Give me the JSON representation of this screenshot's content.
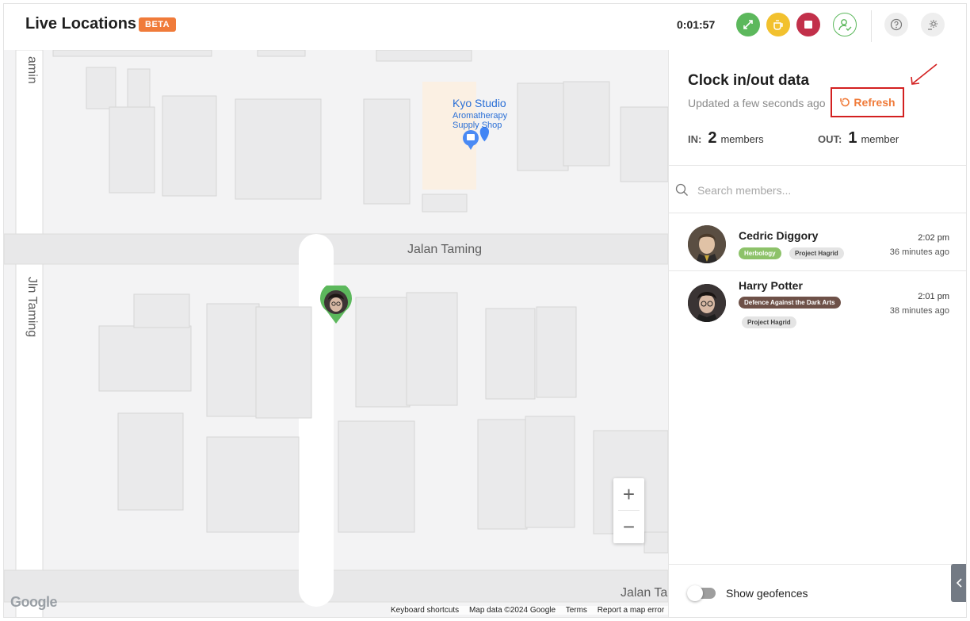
{
  "header": {
    "title": "Live Locations",
    "badge": "BETA",
    "timer": "0:01:57"
  },
  "map": {
    "street_labels": [
      "amin",
      "Jln Taming",
      "Jalan Taming",
      "Jalan Ta"
    ],
    "poi": {
      "name": "Kyo Studio",
      "subtitle": "Aromatherapy Supply Shop"
    },
    "zoom_in": "+",
    "zoom_out": "−",
    "logo": "Google",
    "attribution": [
      "Keyboard shortcuts",
      "Map data ©2024 Google",
      "Terms",
      "Report a map error"
    ]
  },
  "panel": {
    "title": "Clock in/out data",
    "updated": "Updated a few seconds ago",
    "refresh_label": "Refresh",
    "in_label": "IN:",
    "in_count": "2",
    "in_unit": "members",
    "out_label": "OUT:",
    "out_count": "1",
    "out_unit": "member",
    "search_placeholder": "Search members...",
    "members": [
      {
        "name": "Cedric Diggory",
        "tags": [
          "Herbology",
          "Project Hagrid"
        ],
        "time": "2:02 pm",
        "ago": "36 minutes ago"
      },
      {
        "name": "Harry Potter",
        "tags": [
          "Defence Against the Dark Arts",
          "Project Hagrid"
        ],
        "time": "2:01 pm",
        "ago": "38 minutes ago"
      }
    ],
    "geofence_label": "Show geofences"
  },
  "colors": {
    "accent_orange": "#f07b3a",
    "green": "#5cb85c",
    "yellow": "#f2c12e",
    "red": "#c2304a",
    "highlight_red": "#d32020"
  }
}
